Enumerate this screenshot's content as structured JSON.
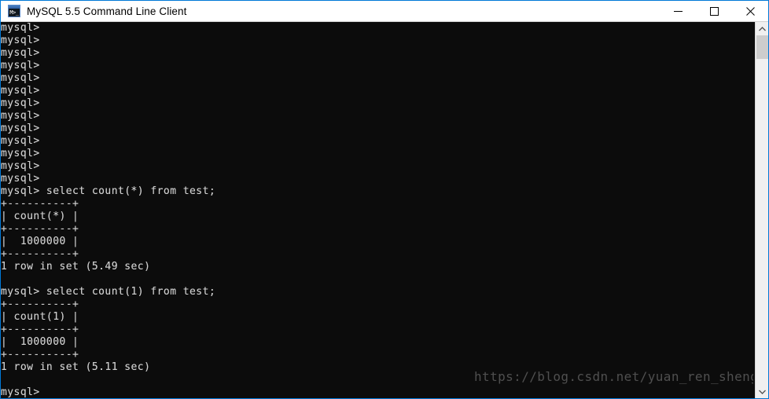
{
  "window": {
    "title": "MySQL 5.5 Command Line Client",
    "icon_name": "mysql-console-icon",
    "icon_glyph": "M>_",
    "border_color": "#0078d7",
    "titlebar_bg": "#ffffff",
    "console_bg": "#0c0c0c",
    "console_fg": "#cccccc"
  },
  "controls": {
    "minimize_label": "—",
    "maximize_label": "□",
    "close_label": "✕"
  },
  "console": {
    "lines": [
      "mysql>",
      "mysql>",
      "mysql>",
      "mysql>",
      "mysql>",
      "mysql>",
      "mysql>",
      "mysql>",
      "mysql>",
      "mysql>",
      "mysql>",
      "mysql>",
      "mysql>",
      "mysql> select count(*) from test;",
      "+----------+",
      "| count(*) |",
      "+----------+",
      "|  1000000 |",
      "+----------+",
      "1 row in set (5.49 sec)",
      "",
      "mysql> select count(1) from test;",
      "+----------+",
      "| count(1) |",
      "+----------+",
      "|  1000000 |",
      "+----------+",
      "1 row in set (5.11 sec)",
      "",
      "mysql>"
    ],
    "prompt": "mysql>",
    "queries": [
      {
        "command": "select count(*) from test;",
        "column": "count(*)",
        "value": "1000000",
        "status": "1 row in set (5.49 sec)"
      },
      {
        "command": "select count(1) from test;",
        "column": "count(1)",
        "value": "1000000",
        "status": "1 row in set (5.11 sec)"
      }
    ]
  },
  "watermark": {
    "text": "https://blog.csdn.net/yuan_ren_sheng",
    "color": "#4f4f4f"
  },
  "scrollbar": {
    "up_arrow": "⌃",
    "down_arrow": "⌄",
    "thumb_color": "#cdcdcd",
    "track_color": "#f0f0f0"
  }
}
